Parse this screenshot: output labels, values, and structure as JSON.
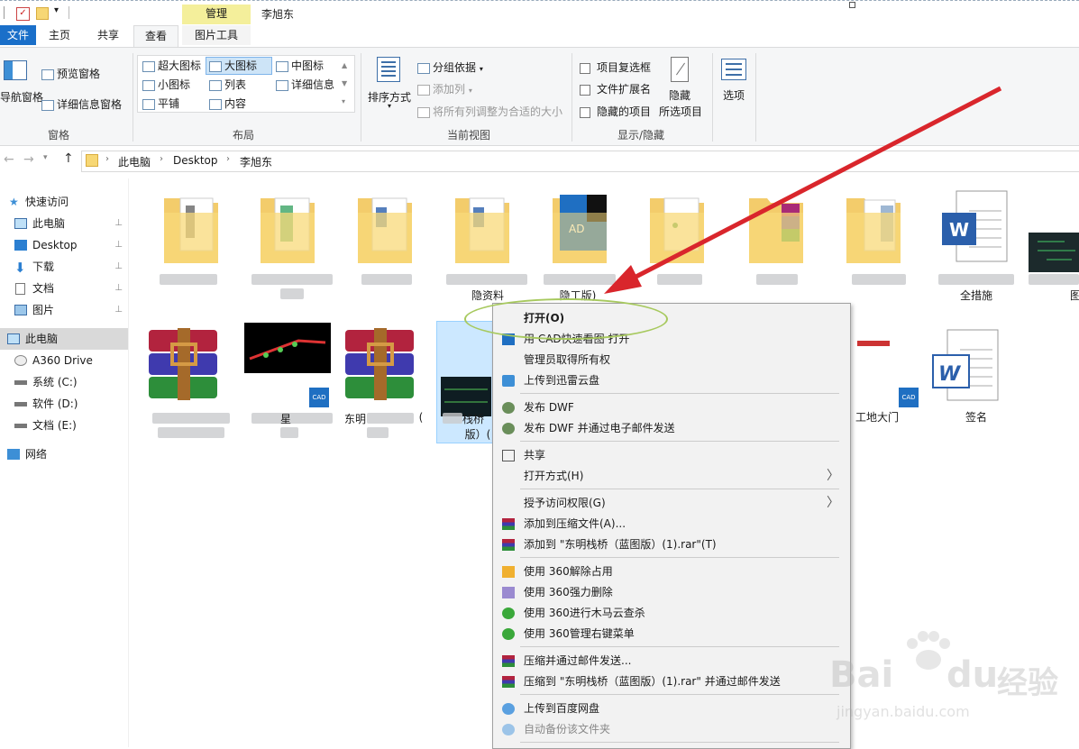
{
  "title_bar": {
    "context_tab": "管理",
    "window_title": "李旭东"
  },
  "ribbon_tabs": {
    "file": "文件",
    "home": "主页",
    "share": "共享",
    "view": "查看",
    "picture_tools": "图片工具"
  },
  "ribbon": {
    "panes": {
      "nav_pane": "导航窗格",
      "preview_pane": "预览窗格",
      "details_pane": "详细信息窗格",
      "group": "窗格"
    },
    "layout": {
      "extra_large": "超大图标",
      "large": "大图标",
      "medium": "中图标",
      "small": "小图标",
      "list": "列表",
      "details": "详细信息",
      "tiles": "平铺",
      "content": "内容",
      "group": "布局"
    },
    "current_view": {
      "sort_by": "排序方式",
      "group_by": "分组依据",
      "add_columns": "添加列",
      "size_all_columns": "将所有列调整为合适的大小",
      "group": "当前视图"
    },
    "show_hide": {
      "item_checkboxes": "项目复选框",
      "file_extensions": "文件扩展名",
      "hidden_items": "隐藏的项目",
      "hide_selected": "隐藏",
      "hide_selected_2": "所选项目",
      "group": "显示/隐藏"
    },
    "options": "选项"
  },
  "address": {
    "crumbs": [
      "此电脑",
      "Desktop",
      "李旭东"
    ]
  },
  "nav_pane": {
    "items": [
      {
        "label": "快速访问",
        "pinned": false
      },
      {
        "label": "此电脑",
        "pinned": true
      },
      {
        "label": "Desktop",
        "pinned": true
      },
      {
        "label": "下载",
        "pinned": true
      },
      {
        "label": "文档",
        "pinned": true
      },
      {
        "label": "图片",
        "pinned": true
      },
      {
        "label": "此电脑",
        "pinned": false
      },
      {
        "label": "A360 Drive",
        "pinned": false
      },
      {
        "label": "系统 (C:)",
        "pinned": false
      },
      {
        "label": "软件 (D:)",
        "pinned": false
      },
      {
        "label": "文档 (E:)",
        "pinned": false
      },
      {
        "label": "网络",
        "pinned": false
      }
    ],
    "pin_glyph": "📌"
  },
  "files": {
    "row1_labels": [
      "",
      "",
      "",
      "",
      "",
      "",
      "",
      "",
      "全措施",
      "图"
    ],
    "row1_partial": [
      "",
      "",
      "",
      "",
      "",
      "",
      "",
      "",
      "",
      ""
    ],
    "visible_text_partial": {
      "f4": "隐资料",
      "f5": "隐工版)",
      "r2f4_a": "栈桥",
      "r2f4_b": "版）(",
      "r2f3": "东明",
      "r2f3b": "(",
      "r2f2": "星"
    },
    "gate": "工地大门",
    "signature": "签名",
    "cad_badge": "CAD",
    "word_letter": "W"
  },
  "context_menu": {
    "items": [
      {
        "label": "打开(O)",
        "bold": true,
        "icon": ""
      },
      {
        "label": "用 CAD快速看图 打开",
        "icon": "cad-icon"
      },
      {
        "label": "管理员取得所有权",
        "icon": ""
      },
      {
        "label": "上传到迅雷云盘",
        "icon": "xunlei-icon"
      },
      {
        "label": "发布 DWF",
        "icon": "dwf-icon"
      },
      {
        "label": "发布 DWF 并通过电子邮件发送",
        "icon": "dwf-icon"
      },
      {
        "label": "共享",
        "icon": "share-icon"
      },
      {
        "label": "打开方式(H)",
        "icon": "",
        "submenu": true
      },
      {
        "label": "授予访问权限(G)",
        "icon": "",
        "submenu": true
      },
      {
        "label": "添加到压缩文件(A)...",
        "icon": "winrar-icon"
      },
      {
        "label": "添加到 \"东明栈桥（蓝图版）(1).rar\"(T)",
        "icon": "winrar-icon"
      },
      {
        "label": "使用 360解除占用",
        "icon": "360-unlock-icon"
      },
      {
        "label": "使用 360强力删除",
        "icon": "360-delete-icon"
      },
      {
        "label": "使用 360进行木马云查杀",
        "icon": "360-scan-icon"
      },
      {
        "label": "使用 360管理右键菜单",
        "icon": "360-menu-icon"
      },
      {
        "label": "压缩并通过邮件发送...",
        "icon": "winrar-icon"
      },
      {
        "label": "压缩到 \"东明栈桥（蓝图版）(1).rar\" 并通过邮件发送",
        "icon": "winrar-icon"
      },
      {
        "label": "上传到百度网盘",
        "icon": "baidu-pan-icon"
      },
      {
        "label": "自动备份该文件夹",
        "icon": "baidu-pan-icon",
        "disabled": true
      }
    ],
    "arrow_glyph": "〉"
  },
  "watermark": {
    "brand": "Bai",
    "brand2": "du",
    "cn": "经验",
    "url": "jingyan.baidu.com"
  },
  "colors": {
    "accent": "#1a6fc9",
    "annotation_arrow": "#d9262c",
    "annotation_oval": "#a7c95e",
    "context_tab": "#f4ef9b"
  }
}
